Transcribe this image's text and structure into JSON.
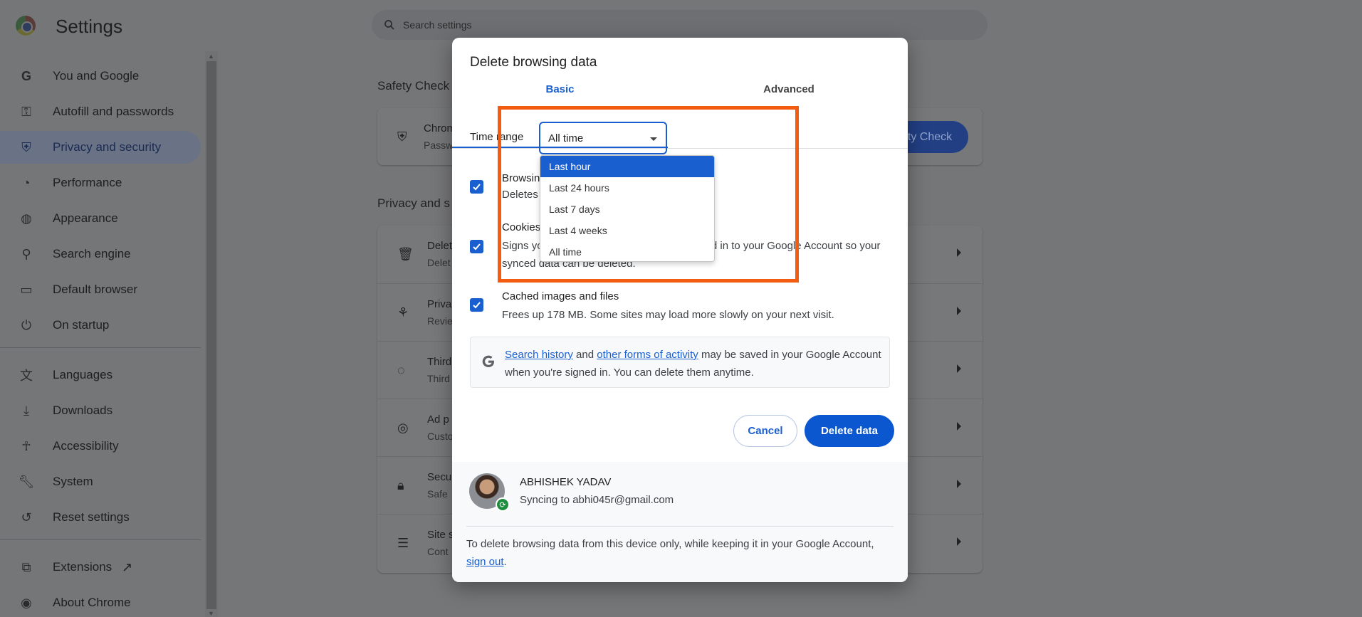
{
  "app": {
    "title": "Settings"
  },
  "search": {
    "placeholder": "Search settings"
  },
  "sidebar": {
    "items": [
      {
        "label": "You and Google",
        "icon": "google-icon"
      },
      {
        "label": "Autofill and passwords",
        "icon": "key-icon"
      },
      {
        "label": "Privacy and security",
        "icon": "shield-icon",
        "active": true
      },
      {
        "label": "Performance",
        "icon": "speedometer-icon"
      },
      {
        "label": "Appearance",
        "icon": "palette-icon"
      },
      {
        "label": "Search engine",
        "icon": "search-icon"
      },
      {
        "label": "Default browser",
        "icon": "browser-icon"
      },
      {
        "label": "On startup",
        "icon": "power-icon"
      },
      {
        "label": "Languages",
        "icon": "translate-icon"
      },
      {
        "label": "Downloads",
        "icon": "download-icon"
      },
      {
        "label": "Accessibility",
        "icon": "accessibility-icon"
      },
      {
        "label": "System",
        "icon": "wrench-icon"
      },
      {
        "label": "Reset settings",
        "icon": "reset-icon"
      },
      {
        "label": "Extensions",
        "icon": "puzzle-icon"
      },
      {
        "label": "About Chrome",
        "icon": "chrome-icon"
      }
    ]
  },
  "main": {
    "safety_heading": "Safety Check",
    "safety_card": {
      "title": "Chrom",
      "sub": "Passw",
      "button": "ety Check"
    },
    "privacy_heading": "Privacy and s",
    "privacy_rows": [
      {
        "title": "Delet",
        "sub": "Delet",
        "icon": "trash-icon"
      },
      {
        "title": "Priva",
        "sub": "Revie",
        "icon": "privacy-guide-icon"
      },
      {
        "title": "Third",
        "sub": "Third",
        "icon": "cookie-icon"
      },
      {
        "title": "Ad p",
        "sub": "Custo",
        "icon": "ad-privacy-icon"
      },
      {
        "title": "Secu",
        "sub": "Safe",
        "icon": "lock-icon"
      },
      {
        "title": "Site s",
        "sub": "Cont",
        "icon": "tune-icon"
      }
    ]
  },
  "dialog": {
    "title": "Delete browsing data",
    "tabs": {
      "basic": "Basic",
      "advanced": "Advanced"
    },
    "time_range": {
      "label": "Time range",
      "value": "All time"
    },
    "options": [
      {
        "title": "Browsing history",
        "sub": "Deletes history from all synced devices",
        "checked": true
      },
      {
        "title": "Cookies and other site data",
        "sub": "Signs you out of most sites. You'll stay signed in to your Google Account so your synced data can be deleted.",
        "checked": true
      },
      {
        "title": "Cached images and files",
        "sub": "Frees up 178 MB. Some sites may load more slowly on your next visit.",
        "checked": true
      }
    ],
    "info": {
      "link1": "Search history",
      "and": " and ",
      "link2": "other forms of activity",
      "rest": " may be saved in your Google Account when you're signed in. You can delete them anytime."
    },
    "buttons": {
      "cancel": "Cancel",
      "delete": "Delete data"
    },
    "account": {
      "name": "ABHISHEK YADAV",
      "sync": "Syncing to abhi045r@gmail.com"
    },
    "footer_note": {
      "text": "To delete browsing data from this device only, while keeping it in your Google Account, ",
      "link": "sign out",
      "end": "."
    }
  },
  "dropdown": {
    "options": [
      "Last hour",
      "Last 24 hours",
      "Last 7 days",
      "Last 4 weeks",
      "All time"
    ],
    "selected_index": 0
  },
  "colors": {
    "accent": "#1a5fd0",
    "highlight": "#f25b10"
  }
}
